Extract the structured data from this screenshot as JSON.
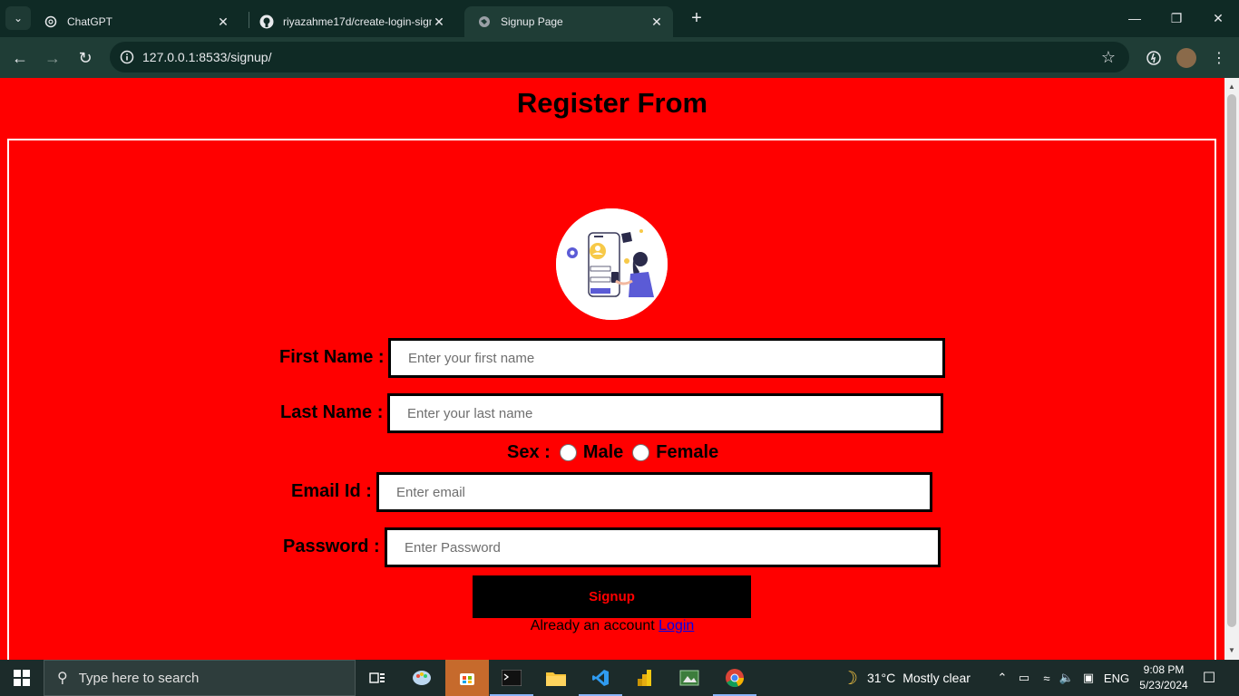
{
  "browser": {
    "tabs": [
      {
        "title": "ChatGPT",
        "icon": "openai-icon",
        "active": false
      },
      {
        "title": "riyazahme17d/create-login-sign",
        "icon": "github-icon",
        "active": false
      },
      {
        "title": "Signup Page",
        "icon": "globe-icon",
        "active": true
      }
    ],
    "url": "127.0.0.1:8533/signup/"
  },
  "page": {
    "title": "Register From",
    "form": {
      "first_name": {
        "label": "First Name :",
        "placeholder": "Enter your first name"
      },
      "last_name": {
        "label": "Last Name :",
        "placeholder": "Enter your last name"
      },
      "sex": {
        "label": "Sex :",
        "options": [
          "Male",
          "Female"
        ]
      },
      "email": {
        "label": "Email Id :",
        "placeholder": "Enter email"
      },
      "password": {
        "label": "Password :",
        "placeholder": "Enter Password"
      },
      "submit_label": "Signup",
      "already_text": "Already an account",
      "login_link": "Login"
    },
    "colors": {
      "background": "#ff0000",
      "button": "#000000",
      "button_text": "#ff0000"
    }
  },
  "taskbar": {
    "search_placeholder": "Type here to search",
    "weather": {
      "temp": "31°C",
      "condition": "Mostly clear"
    },
    "language": "ENG",
    "time": "9:08 PM",
    "date": "5/23/2024"
  }
}
